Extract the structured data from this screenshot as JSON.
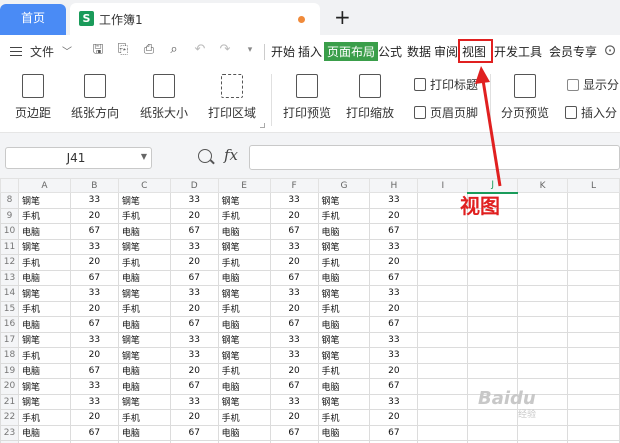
{
  "tabs": {
    "home": "首页",
    "doc_icon": "S",
    "doc_title": "工作簿1",
    "add": "+"
  },
  "menubar": {
    "file": "文件",
    "items": [
      "开始",
      "插入",
      "页面布局",
      "公式",
      "数据",
      "审阅",
      "视图",
      "开发工具",
      "会员专享"
    ],
    "active": "页面布局",
    "highlighted": "视图"
  },
  "ribbon": {
    "margins": "页边距",
    "orientation": "纸张方向",
    "size": "纸张大小",
    "print_area": "打印区域",
    "print_preview": "打印预览",
    "print_scale": "打印缩放",
    "print_titles": "打印标题",
    "header_footer": "页眉页脚",
    "page_break_preview": "分页预览",
    "show_breaks": "显示分",
    "insert_break": "插入分"
  },
  "formula_bar": {
    "cell_ref": "J41",
    "fx": "fx"
  },
  "grid": {
    "columns": [
      "A",
      "B",
      "C",
      "D",
      "E",
      "F",
      "G",
      "H",
      "I",
      "J",
      "K",
      "L"
    ],
    "selected_column": "J",
    "rows": [
      {
        "n": "8",
        "cells": [
          "钢笔",
          "33",
          "钢笔",
          "33",
          "钢笔",
          "33",
          "钢笔",
          "33"
        ]
      },
      {
        "n": "9",
        "cells": [
          "手机",
          "20",
          "手机",
          "20",
          "手机",
          "20",
          "手机",
          "20"
        ]
      },
      {
        "n": "10",
        "cells": [
          "电脑",
          "67",
          "电脑",
          "67",
          "电脑",
          "67",
          "电脑",
          "67"
        ]
      },
      {
        "n": "11",
        "cells": [
          "钢笔",
          "33",
          "钢笔",
          "33",
          "钢笔",
          "33",
          "钢笔",
          "33"
        ]
      },
      {
        "n": "12",
        "cells": [
          "手机",
          "20",
          "手机",
          "20",
          "手机",
          "20",
          "手机",
          "20"
        ]
      },
      {
        "n": "13",
        "cells": [
          "电脑",
          "67",
          "电脑",
          "67",
          "电脑",
          "67",
          "电脑",
          "67"
        ]
      },
      {
        "n": "14",
        "cells": [
          "钢笔",
          "33",
          "钢笔",
          "33",
          "钢笔",
          "33",
          "钢笔",
          "33"
        ]
      },
      {
        "n": "15",
        "cells": [
          "手机",
          "20",
          "手机",
          "20",
          "手机",
          "20",
          "手机",
          "20"
        ]
      },
      {
        "n": "16",
        "cells": [
          "电脑",
          "67",
          "电脑",
          "67",
          "电脑",
          "67",
          "电脑",
          "67"
        ]
      },
      {
        "n": "17",
        "cells": [
          "钢笔",
          "33",
          "钢笔",
          "33",
          "钢笔",
          "33",
          "钢笔",
          "33"
        ]
      },
      {
        "n": "18",
        "cells": [
          "手机",
          "20",
          "钢笔",
          "33",
          "钢笔",
          "33",
          "钢笔",
          "33"
        ]
      },
      {
        "n": "19",
        "cells": [
          "电脑",
          "67",
          "电脑",
          "20",
          "手机",
          "20",
          "手机",
          "20"
        ]
      },
      {
        "n": "20",
        "cells": [
          "钢笔",
          "33",
          "电脑",
          "67",
          "电脑",
          "67",
          "电脑",
          "67"
        ]
      },
      {
        "n": "21",
        "cells": [
          "钢笔",
          "33",
          "钢笔",
          "33",
          "钢笔",
          "33",
          "钢笔",
          "33"
        ]
      },
      {
        "n": "22",
        "cells": [
          "手机",
          "20",
          "手机",
          "20",
          "手机",
          "20",
          "手机",
          "20"
        ]
      },
      {
        "n": "23",
        "cells": [
          "电脑",
          "67",
          "电脑",
          "67",
          "电脑",
          "67",
          "电脑",
          "67"
        ]
      },
      {
        "n": "24",
        "cells": [
          "钢笔",
          "33",
          "钢笔",
          "33",
          "钢笔",
          "33",
          "钢笔",
          "33"
        ]
      }
    ]
  },
  "annotation": {
    "label": "视图",
    "color": "#e02020"
  },
  "watermark": {
    "brand": "Baidu",
    "sub": "经验"
  },
  "colors": {
    "home_tab": "#4a8bf5",
    "active_menu": "#3a9e4a",
    "sheet_icon": "#1a9b5a"
  }
}
